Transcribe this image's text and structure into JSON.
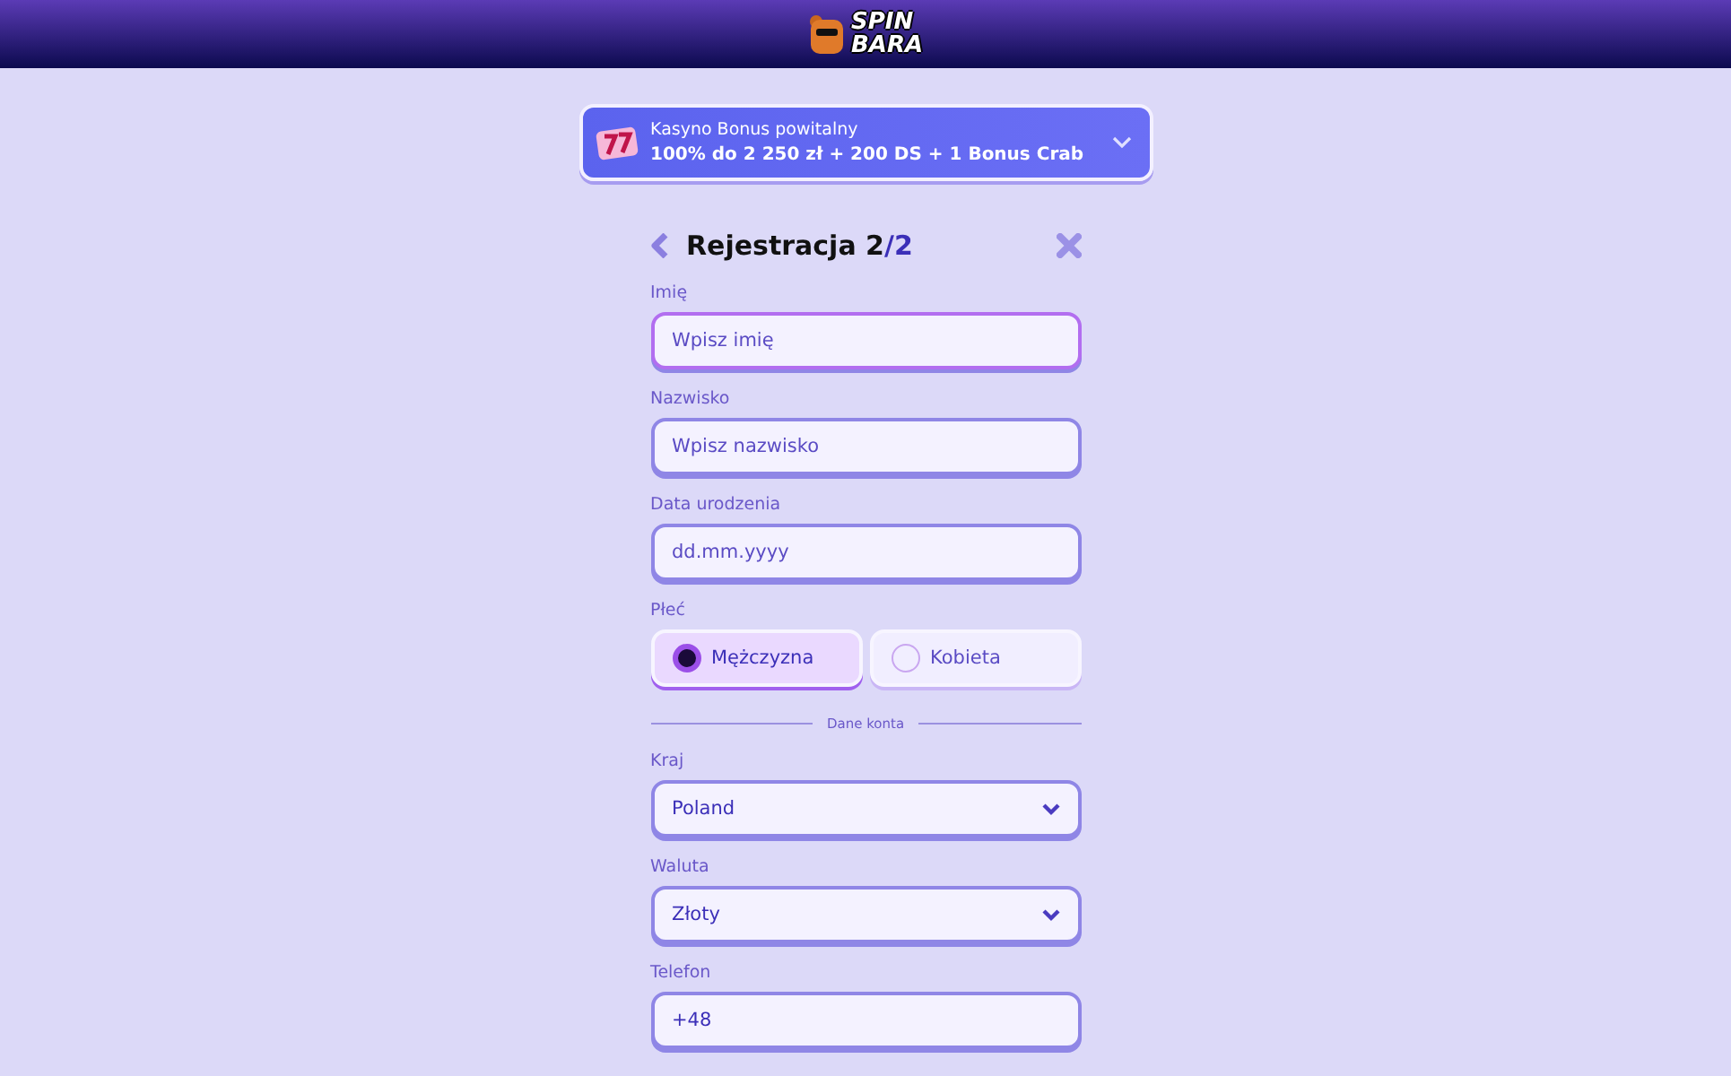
{
  "logo": {
    "line_1": "SPIN",
    "line_2": "BARA"
  },
  "bonus": {
    "title": "Kasyno Bonus powitalny",
    "offer": "100% do 2 250 zł + 200 DS + 1 Bonus Crab"
  },
  "form": {
    "title": "Rejestracja 2",
    "step": "/2",
    "fields": [
      {
        "kind": "text",
        "label": "Imię",
        "placeholder": "Wpisz imię",
        "focused": true
      },
      {
        "kind": "text",
        "label": "Nazwisko",
        "placeholder": "Wpisz nazwisko",
        "focused": false
      },
      {
        "kind": "text",
        "label": "Data urodzenia",
        "placeholder": "dd.mm.yyyy",
        "focused": false
      },
      {
        "kind": "radio",
        "label": "Płeć",
        "options": [
          {
            "label": "Mężczyzna",
            "selected": true
          },
          {
            "label": "Kobieta",
            "selected": false
          }
        ]
      },
      {
        "kind": "divider",
        "label": "Dane konta"
      },
      {
        "kind": "select",
        "label": "Kraj",
        "value": "Poland"
      },
      {
        "kind": "select",
        "label": "Waluta",
        "value": "Złoty"
      },
      {
        "kind": "text",
        "label": "Telefon",
        "value": "+48",
        "focused": false
      }
    ]
  }
}
